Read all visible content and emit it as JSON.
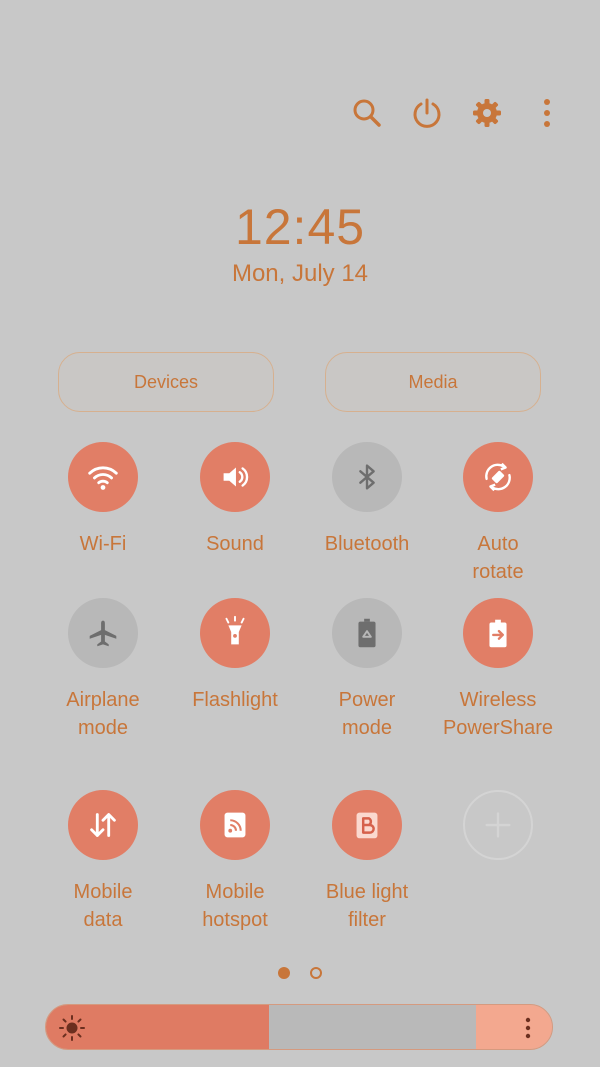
{
  "topbar": {
    "icons": [
      "search-icon",
      "power-icon",
      "settings-gear-icon",
      "more-vert-icon"
    ]
  },
  "clock": {
    "time": "12:45",
    "date": "Mon, July 14"
  },
  "buttons": {
    "devices": "Devices",
    "media": "Media"
  },
  "tiles": [
    {
      "label": "Wi-Fi",
      "state": "on",
      "icon": "wifi-icon"
    },
    {
      "label": "Sound",
      "state": "on",
      "icon": "sound-icon"
    },
    {
      "label": "Bluetooth",
      "state": "off",
      "icon": "bluetooth-icon"
    },
    {
      "label": "Auto\nrotate",
      "state": "on",
      "icon": "auto-rotate-icon"
    },
    {
      "label": "Airplane\nmode",
      "state": "off",
      "icon": "airplane-icon"
    },
    {
      "label": "Flashlight",
      "state": "on",
      "icon": "flashlight-icon"
    },
    {
      "label": "Power\nmode",
      "state": "off",
      "icon": "power-mode-icon"
    },
    {
      "label": "Wireless\nPowerShare",
      "state": "on",
      "icon": "wireless-powershare-icon"
    },
    {
      "label": "Mobile\ndata",
      "state": "on",
      "icon": "mobile-data-icon"
    },
    {
      "label": "Mobile\nhotspot",
      "state": "on",
      "icon": "mobile-hotspot-icon"
    },
    {
      "label": "Blue light\nfilter",
      "state": "on",
      "icon": "blue-light-filter-icon"
    },
    {
      "label": "",
      "state": "add",
      "icon": "add-icon"
    }
  ],
  "pager": {
    "pages": 2,
    "current": 1
  },
  "brightness": {
    "level": 0.44,
    "icons": [
      "sun-icon",
      "more-vert-icon"
    ]
  },
  "colors": {
    "accent": "#c8763a",
    "tile_on": "#e17e66",
    "tile_off": "#b8b8b8",
    "background": "#c8c8c8"
  }
}
